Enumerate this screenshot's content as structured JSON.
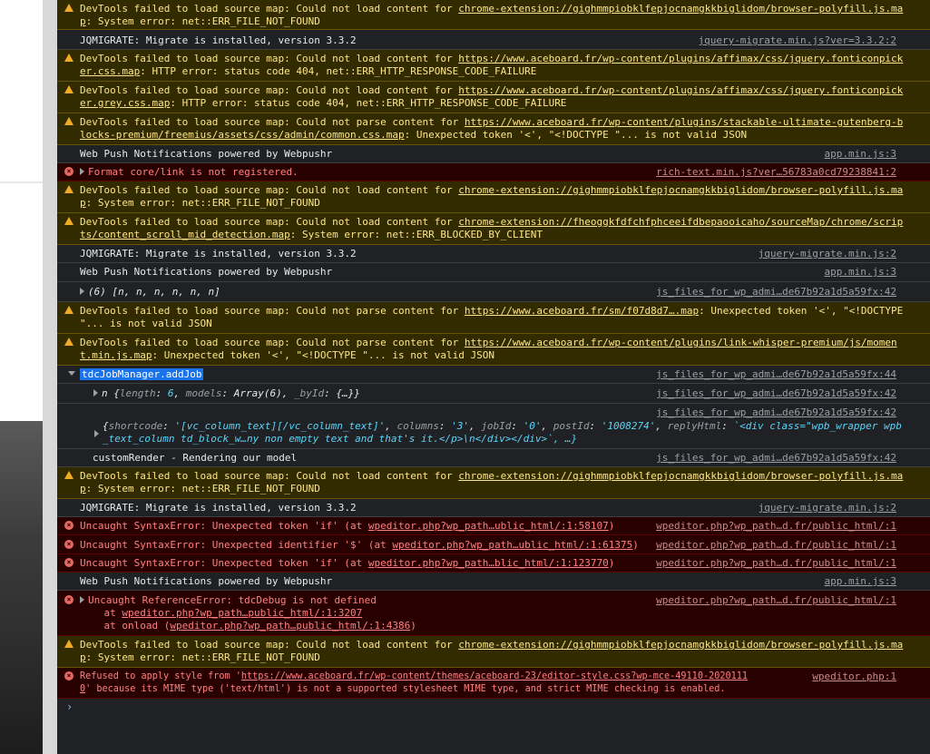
{
  "rows": {
    "r1": {
      "m1a": "DevTools failed to load source map: Could not load content for ",
      "u1": "chrome-extension://gighmmpiobklfepjocnamgkkbiglidom/browser-polyfill.js.ma",
      "u2": "p",
      "m1b": ": System error: net::ERR_FILE_NOT_FOUND"
    },
    "r2": {
      "msg": "JQMIGRATE: Migrate is installed, version 3.3.2",
      "src": "jquery-migrate.min.js?ver=3.3.2:2"
    },
    "r3": {
      "m1a": "DevTools failed to load source map: Could not load content for ",
      "u1": "https://www.aceboard.fr/wp-content/plugins/affimax/css/jquery.fonticonpick",
      "u2": "er.css.map",
      "m1b": ": HTTP error: status code 404, net::ERR_HTTP_RESPONSE_CODE_FAILURE"
    },
    "r4": {
      "m1a": "DevTools failed to load source map: Could not load content for ",
      "u1": "https://www.aceboard.fr/wp-content/plugins/affimax/css/jquery.fonticonpick",
      "u2": "er.grey.css.map",
      "m1b": ": HTTP error: status code 404, net::ERR_HTTP_RESPONSE_CODE_FAILURE"
    },
    "r5": {
      "m1a": "DevTools failed to load source map: Could not parse content for ",
      "u1": "https://www.aceboard.fr/wp-content/plugins/stackable-ultimate-gutenberg-b",
      "u2": "locks-premium/freemius/assets/css/admin/common.css.map",
      "m1b": ": Unexpected token '<', \"<!DOCTYPE \"... is not valid JSON"
    },
    "r6": {
      "msg": "Web Push Notifications powered by Webpushr",
      "src": "app.min.js:3"
    },
    "r7": {
      "msg": "Format core/link is not registered.",
      "src": "rich-text.min.js?ver…56783a0cd79238841:2"
    },
    "r8": {
      "m1a": "DevTools failed to load source map: Could not load content for ",
      "u1": "chrome-extension://gighmmpiobklfepjocnamgkkbiglidom/browser-polyfill.js.ma",
      "u2": "p",
      "m1b": ": System error: net::ERR_FILE_NOT_FOUND"
    },
    "r9": {
      "m1a": "DevTools failed to load source map: Could not load content for ",
      "u1": "chrome-extension://fheoggkfdfchfphceeifdbepaooicaho/sourceMap/chrome/scrip",
      "u2": "ts/content_scroll_mid_detection.map",
      "m1b": ": System error: net::ERR_BLOCKED_BY_CLIENT"
    },
    "r10": {
      "msg": "JQMIGRATE: Migrate is installed, version 3.3.2",
      "src": "jquery-migrate.min.js:2"
    },
    "r11": {
      "msg": "Web Push Notifications powered by Webpushr",
      "src": "app.min.js:3"
    },
    "r12": {
      "msg": "(6) [n, n, n, n, n, n]",
      "src": "js_files_for_wp_admi…de67b92a1d5a59fx:42"
    },
    "r13": {
      "m1a": "DevTools failed to load source map: Could not parse content for ",
      "u1": "https://www.aceboard.fr/sm/f07d8d7….map",
      "m1b": ": Unexpected token '<', \"<!DOCTYPE",
      "l2": "\"... is not valid JSON"
    },
    "r14": {
      "m1a": "DevTools failed to load source map: Could not parse content for ",
      "u1": "https://www.aceboard.fr/wp-content/plugins/link-whisper-premium/js/momen",
      "u2": "t.min.js.map",
      "m1b": ": Unexpected token '<', \"<!DOCTYPE \"... is not valid JSON"
    },
    "r15": {
      "msg": "tdcJobManager.addJob",
      "src": "js_files_for_wp_admi…de67b92a1d5a59fx:44"
    },
    "r16": {
      "n": "n ",
      "o": "{",
      "k1": "length",
      "v1": "6",
      "k2": "models",
      "v2": "Array(6)",
      "k3": "_byId",
      "v3": "{…}",
      "c": "}",
      "src": "js_files_for_wp_admi…de67b92a1d5a59fx:42"
    },
    "r17": {
      "src": "js_files_for_wp_admi…de67b92a1d5a59fx:42",
      "k1": "shortcode",
      "v1": "'[vc_column_text][/vc_column_text]'",
      "k2": "columns",
      "v2": "'3'",
      "k3": "jobId",
      "v3": "'0'",
      "k4": "postId",
      "v4": "'1008274'",
      "k5": "replyHtml",
      "v5": "`<div class=\"wpb_wrapper wpb",
      "l2": "_text_column td_block_w…ny non empty text and that's it.</p>\\n</div></div>`, …}"
    },
    "r18": {
      "msg": "customRender - Rendering our model",
      "src": "js_files_for_wp_admi…de67b92a1d5a59fx:42"
    },
    "r19": {
      "m1a": "DevTools failed to load source map: Could not load content for ",
      "u1": "chrome-extension://gighmmpiobklfepjocnamgkkbiglidom/browser-polyfill.js.ma",
      "u2": "p",
      "m1b": ": System error: net::ERR_FILE_NOT_FOUND"
    },
    "r20": {
      "msg": "JQMIGRATE: Migrate is installed, version 3.3.2",
      "src": "jquery-migrate.min.js:2"
    },
    "r21": {
      "m1": "Uncaught SyntaxError: Unexpected token 'if' (at ",
      "u": "wpeditor.php?wp_path…ublic_html/:1:58107",
      "m2": ")",
      "src": "wpeditor.php?wp_path…d.fr/public_html/:1"
    },
    "r22": {
      "m1": "Uncaught SyntaxError: Unexpected identifier '$' (at ",
      "u": "wpeditor.php?wp_path…ublic_html/:1:61375",
      "m2": ")",
      "src": "wpeditor.php?wp_path…d.fr/public_html/:1"
    },
    "r23": {
      "m1": "Uncaught SyntaxError: Unexpected token 'if' (at ",
      "u": "wpeditor.php?wp_path…blic_html/:1:123770",
      "m2": ")",
      "src": "wpeditor.php?wp_path…d.fr/public_html/:1"
    },
    "r24": {
      "msg": "Web Push Notifications powered by Webpushr",
      "src": "app.min.js:3"
    },
    "r25": {
      "l1": "Uncaught ReferenceError: tdcDebug is not defined",
      "a1": "    at ",
      "u1": "wpeditor.php?wp_path…public_html/:1:3207",
      "a2": "    at onload (",
      "u2": "wpeditor.php?wp_path…public_html/:1:4386",
      "a3": ")",
      "src": "wpeditor.php?wp_path…d.fr/public_html/:1"
    },
    "r26": {
      "m1a": "DevTools failed to load source map: Could not load content for ",
      "u1": "chrome-extension://gighmmpiobklfepjocnamgkkbiglidom/browser-polyfill.js.ma",
      "u2": "p",
      "m1b": ": System error: net::ERR_FILE_NOT_FOUND"
    },
    "r27": {
      "m1": "Refused to apply style from '",
      "u1": "https://www.aceboard.fr/wp-content/themes/aceboard-23/editor-style.css?wp-mce-49110-2020111",
      "u2": "0",
      "m2": "' because its MIME type ('text/html') is not a supported stylesheet MIME type, and strict MIME checking is enabled.",
      "src": "wpeditor.php:1"
    }
  },
  "prompt": "›",
  "icons": {
    "warning": "warning-triangle-icon",
    "error": "error-circle-icon",
    "x": "×"
  }
}
